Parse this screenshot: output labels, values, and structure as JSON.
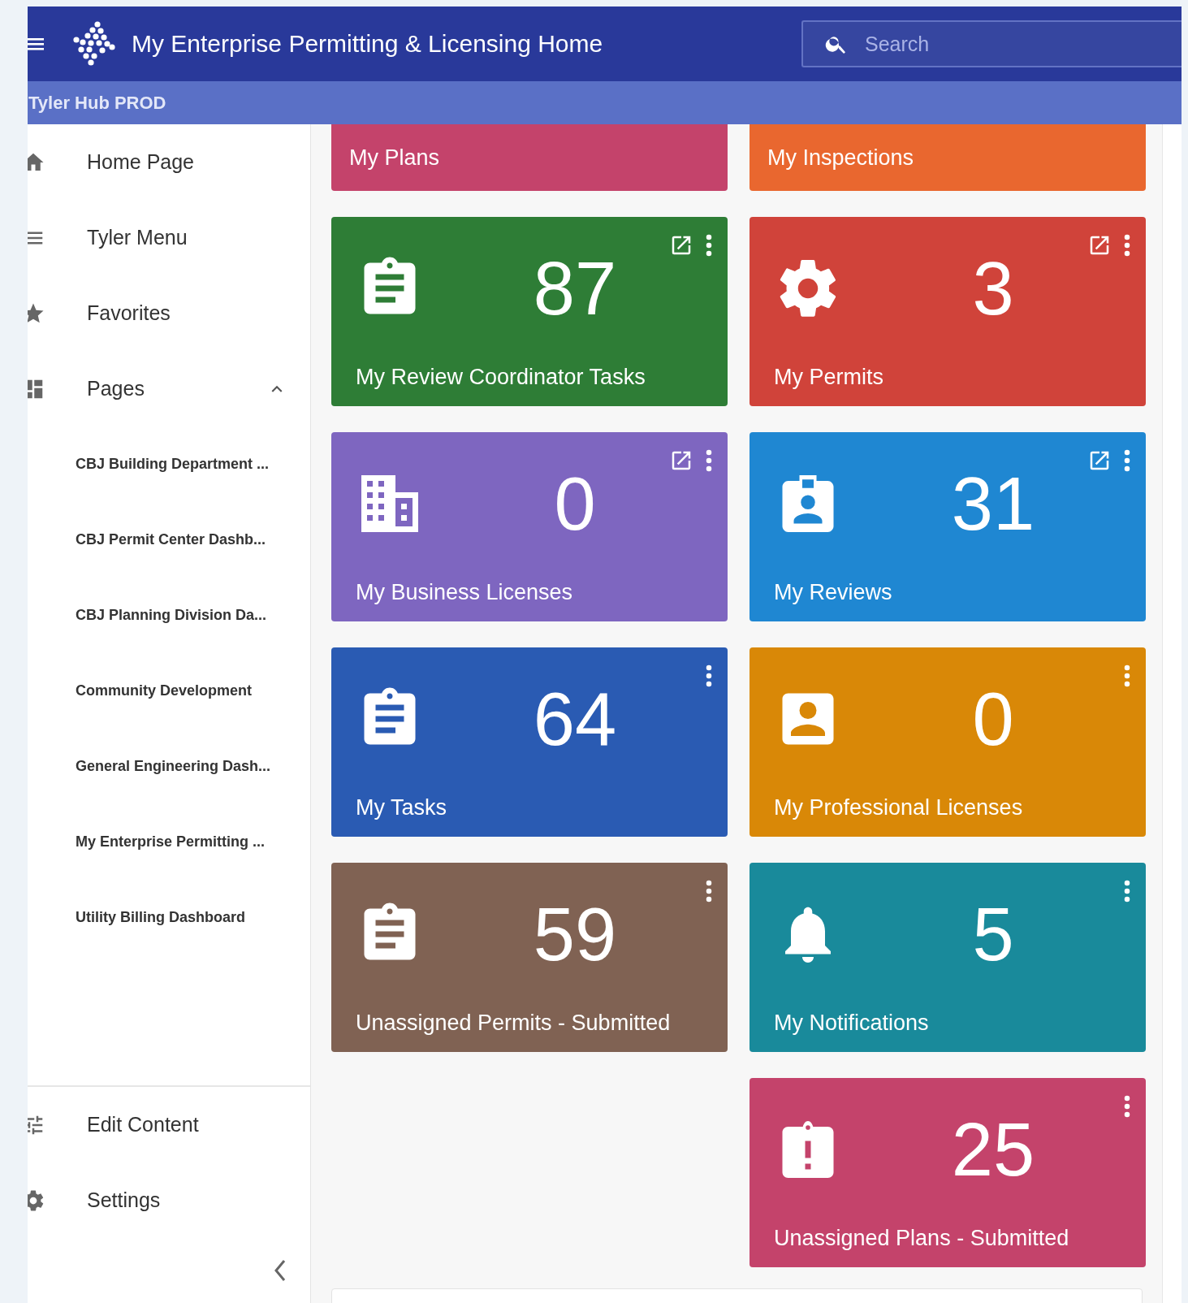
{
  "header": {
    "title": "My Enterprise Permitting & Licensing Home",
    "search": {
      "placeholder": "Search"
    }
  },
  "subheader": {
    "title": "Tyler Hub PROD"
  },
  "sidebar": {
    "items": [
      {
        "label": "Home Page"
      },
      {
        "label": "Tyler Menu"
      },
      {
        "label": "Favorites"
      },
      {
        "label": "Pages",
        "expanded": true,
        "children": [
          {
            "label": "CBJ Building Department ..."
          },
          {
            "label": "CBJ Permit Center Dashb..."
          },
          {
            "label": "CBJ Planning Division Da..."
          },
          {
            "label": "Community Development"
          },
          {
            "label": "General Engineering Dash..."
          },
          {
            "label": "My Enterprise Permitting ..."
          },
          {
            "label": "Utility Billing Dashboard"
          }
        ]
      }
    ],
    "bottom_items": [
      {
        "label": "Edit Content"
      },
      {
        "label": "Settings"
      }
    ]
  },
  "dashboard": {
    "rows": [
      {
        "left": {
          "kind": "header",
          "title": "My Plans",
          "color": "#c4436b"
        },
        "right": {
          "kind": "header",
          "title": "My Inspections",
          "color": "#e9672f"
        }
      },
      {
        "left": {
          "kind": "tile",
          "title": "My Review Coordinator Tasks",
          "count": "87",
          "open_link": true,
          "color": "#2e7d36"
        },
        "right": {
          "kind": "tile",
          "title": "My Permits",
          "count": "3",
          "open_link": true,
          "color": "#d0433a"
        }
      },
      {
        "left": {
          "kind": "tile",
          "title": "My Business Licenses",
          "count": "0",
          "open_link": true,
          "color": "#7e66c0"
        },
        "right": {
          "kind": "tile",
          "title": "My Reviews",
          "count": "31",
          "open_link": true,
          "color": "#1f87d2"
        }
      },
      {
        "left": {
          "kind": "tile",
          "title": "My Tasks",
          "count": "64",
          "open_link": false,
          "color": "#2a5bb3"
        },
        "right": {
          "kind": "tile",
          "title": "My Professional Licenses",
          "count": "0",
          "open_link": false,
          "color": "#d98807"
        }
      },
      {
        "left": {
          "kind": "tile",
          "title": "Unassigned Permits - Submitted",
          "count": "59",
          "open_link": false,
          "color": "#806253"
        },
        "right": {
          "kind": "tile",
          "title": "My Notifications",
          "count": "5",
          "open_link": false,
          "color": "#198a9b"
        }
      },
      {
        "right": {
          "kind": "tile",
          "title": "Unassigned Plans - Submitted",
          "count": "25",
          "open_link": false,
          "color": "#c4436b"
        }
      }
    ]
  }
}
